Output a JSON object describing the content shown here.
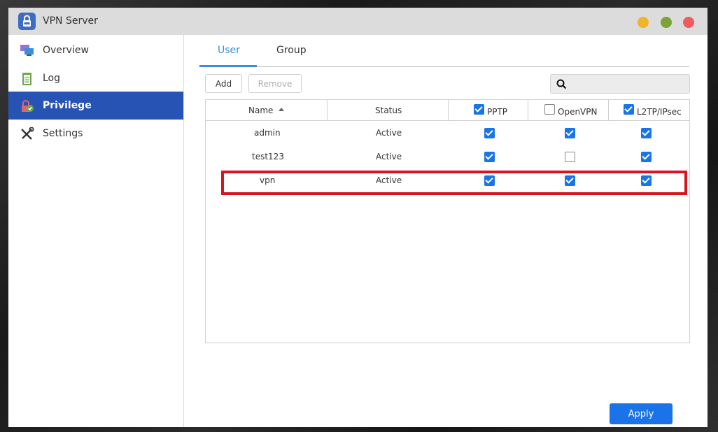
{
  "window": {
    "title": "VPN Server",
    "icon": "vpn-lock-icon"
  },
  "sidebar": {
    "items": [
      {
        "label": "Overview",
        "icon": "monitor-icon",
        "active": false
      },
      {
        "label": "Log",
        "icon": "log-clipboard-icon",
        "active": false
      },
      {
        "label": "Privilege",
        "icon": "privilege-lock-icon",
        "active": true
      },
      {
        "label": "Settings",
        "icon": "tools-icon",
        "active": false
      }
    ]
  },
  "tabs": [
    {
      "label": "User",
      "active": true
    },
    {
      "label": "Group",
      "active": false
    }
  ],
  "toolbar": {
    "add_label": "Add",
    "remove_label": "Remove",
    "search_placeholder": ""
  },
  "table": {
    "columns": [
      {
        "label": "Name",
        "sorted": "ascending"
      },
      {
        "label": "Status"
      },
      {
        "label": "PPTP",
        "checked": true
      },
      {
        "label": "OpenVPN",
        "checked": false
      },
      {
        "label": "L2TP/IPsec",
        "checked": true
      }
    ],
    "rows": [
      {
        "name": "admin",
        "status": "Active",
        "pptp": true,
        "openvpn": true,
        "l2tp": true
      },
      {
        "name": "test123",
        "status": "Active",
        "pptp": true,
        "openvpn": false,
        "l2tp": true
      },
      {
        "name": "vpn",
        "status": "Active",
        "pptp": true,
        "openvpn": true,
        "l2tp": true
      }
    ],
    "highlighted_row": "vpn"
  },
  "footer": {
    "apply_label": "Apply"
  },
  "colors": {
    "accent": "#1a73e8",
    "sidebar_active": "#2753b5",
    "tab_active": "#3a8fd8",
    "highlight": "#d7151e",
    "traffic_min": "#f0b429",
    "traffic_max": "#7aa33a",
    "traffic_close": "#f05b5b"
  }
}
